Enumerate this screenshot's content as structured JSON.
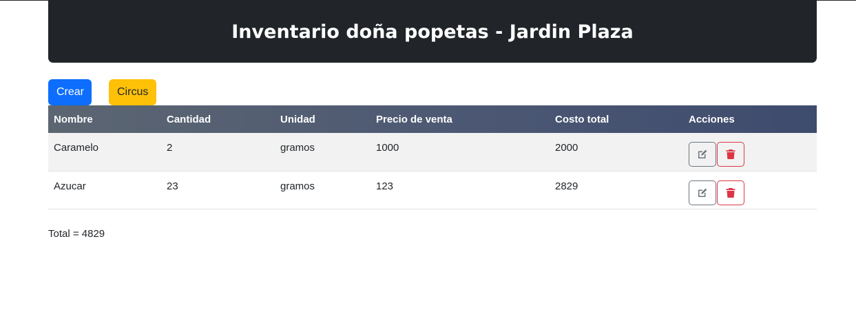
{
  "header": {
    "title": "Inventario doña popetas - Jardin Plaza"
  },
  "toolbar": {
    "create_label": "Crear",
    "circus_label": "Circus"
  },
  "table": {
    "columns": [
      "Nombre",
      "Cantidad",
      "Unidad",
      "Precio de venta",
      "Costo total",
      "Acciones"
    ],
    "rows": [
      {
        "nombre": "Caramelo",
        "cantidad": "2",
        "unidad": "gramos",
        "precio": "1000",
        "costo": "2000"
      },
      {
        "nombre": "Azucar",
        "cantidad": "23",
        "unidad": "gramos",
        "precio": "123",
        "costo": "2829"
      }
    ]
  },
  "footer": {
    "total_text": "Total = 4829"
  },
  "colors": {
    "header_bg": "#212529",
    "primary": "#0d6efd",
    "warning": "#ffc107",
    "danger": "#dc3545",
    "secondary": "#6c757d"
  },
  "icons": {
    "edit": "edit-icon",
    "delete": "trash-icon"
  }
}
